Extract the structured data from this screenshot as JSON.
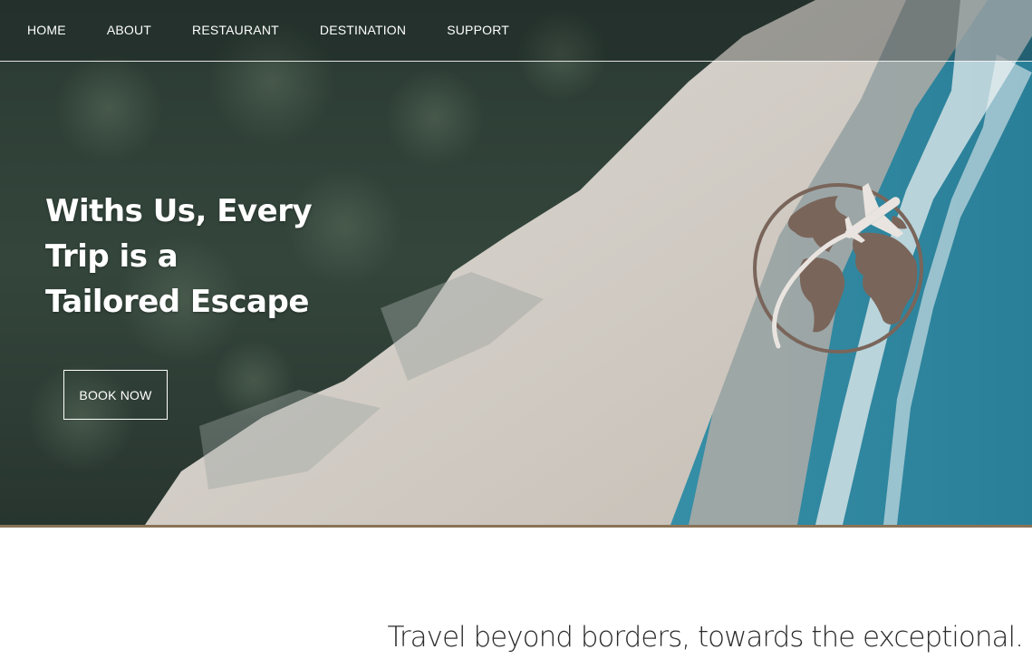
{
  "nav": {
    "items": [
      {
        "label": "HOME"
      },
      {
        "label": "ABOUT"
      },
      {
        "label": "RESTAURANT"
      },
      {
        "label": "DESTINATION"
      },
      {
        "label": "SUPPORT"
      }
    ]
  },
  "hero": {
    "headline_lines": [
      "Withs Us, Every",
      "Trip is a",
      "Tailored Escape"
    ],
    "cta_label": "BOOK NOW",
    "background": "aerial-beach-forest-image",
    "logo_icon": "globe-airplane-icon"
  },
  "tagline": "Travel beyond borders, towards the exceptional.",
  "colors": {
    "accent_border": "#8a7356",
    "logo_brown": "#7a655a",
    "text_dark": "#2b2b2b"
  }
}
